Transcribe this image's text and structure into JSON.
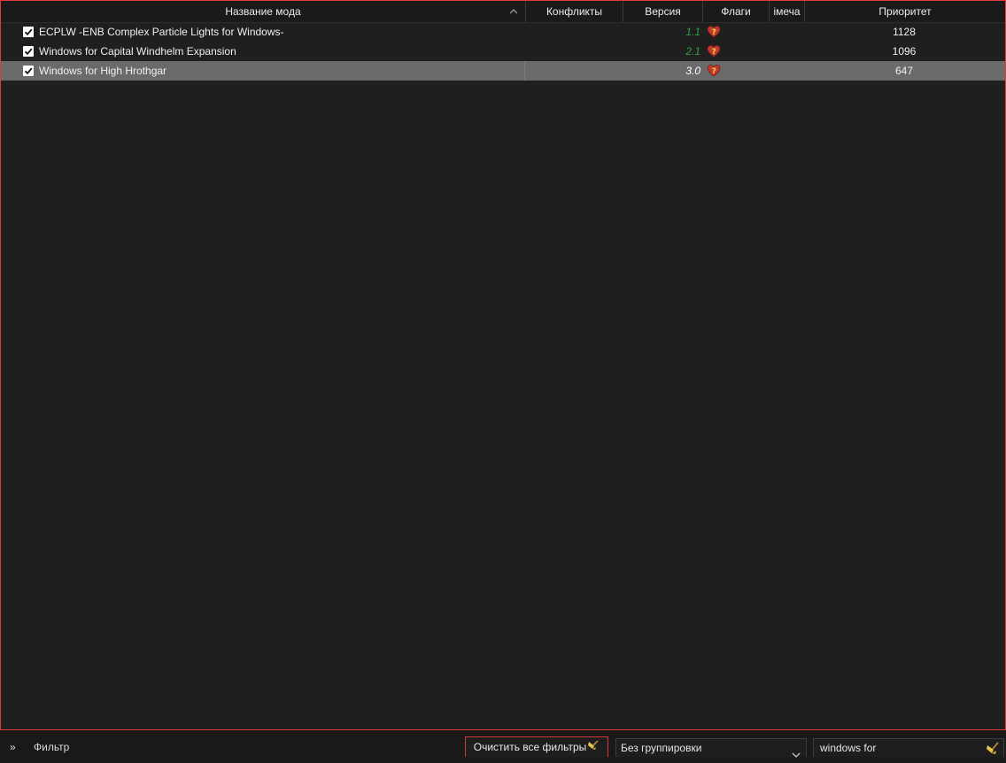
{
  "columns": {
    "name": "Название мода",
    "conflicts": "Конфликты",
    "version": "Версия",
    "flags": "Флаги",
    "notes": "імеча",
    "priority": "Приоритет"
  },
  "mods": [
    {
      "enabled": true,
      "name": "ECPLW -ENB Complex Particle Lights for Windows-",
      "version": "1.1",
      "priority": "1128",
      "selected": false,
      "version_color": "#2ea043"
    },
    {
      "enabled": true,
      "name": "Windows for Capital Windhelm Expansion",
      "version": "2.1",
      "priority": "1096",
      "selected": false,
      "version_color": "#2ea043"
    },
    {
      "enabled": true,
      "name": "Windows for High Hrothgar",
      "version": "3.0",
      "priority": "647",
      "selected": true,
      "version_color": "#ffffff"
    }
  ],
  "flag_icon": "heart-question-icon",
  "bottom": {
    "expand_glyph": "»",
    "filter_label": "Фильтр",
    "clear_filters": "Очистить все фильтры",
    "grouping": "Без группировки",
    "search_value": "windows for"
  },
  "colors": {
    "accent_border": "#e03c3c",
    "selected_row": "#6a6a6a",
    "version_green": "#2ea043"
  }
}
